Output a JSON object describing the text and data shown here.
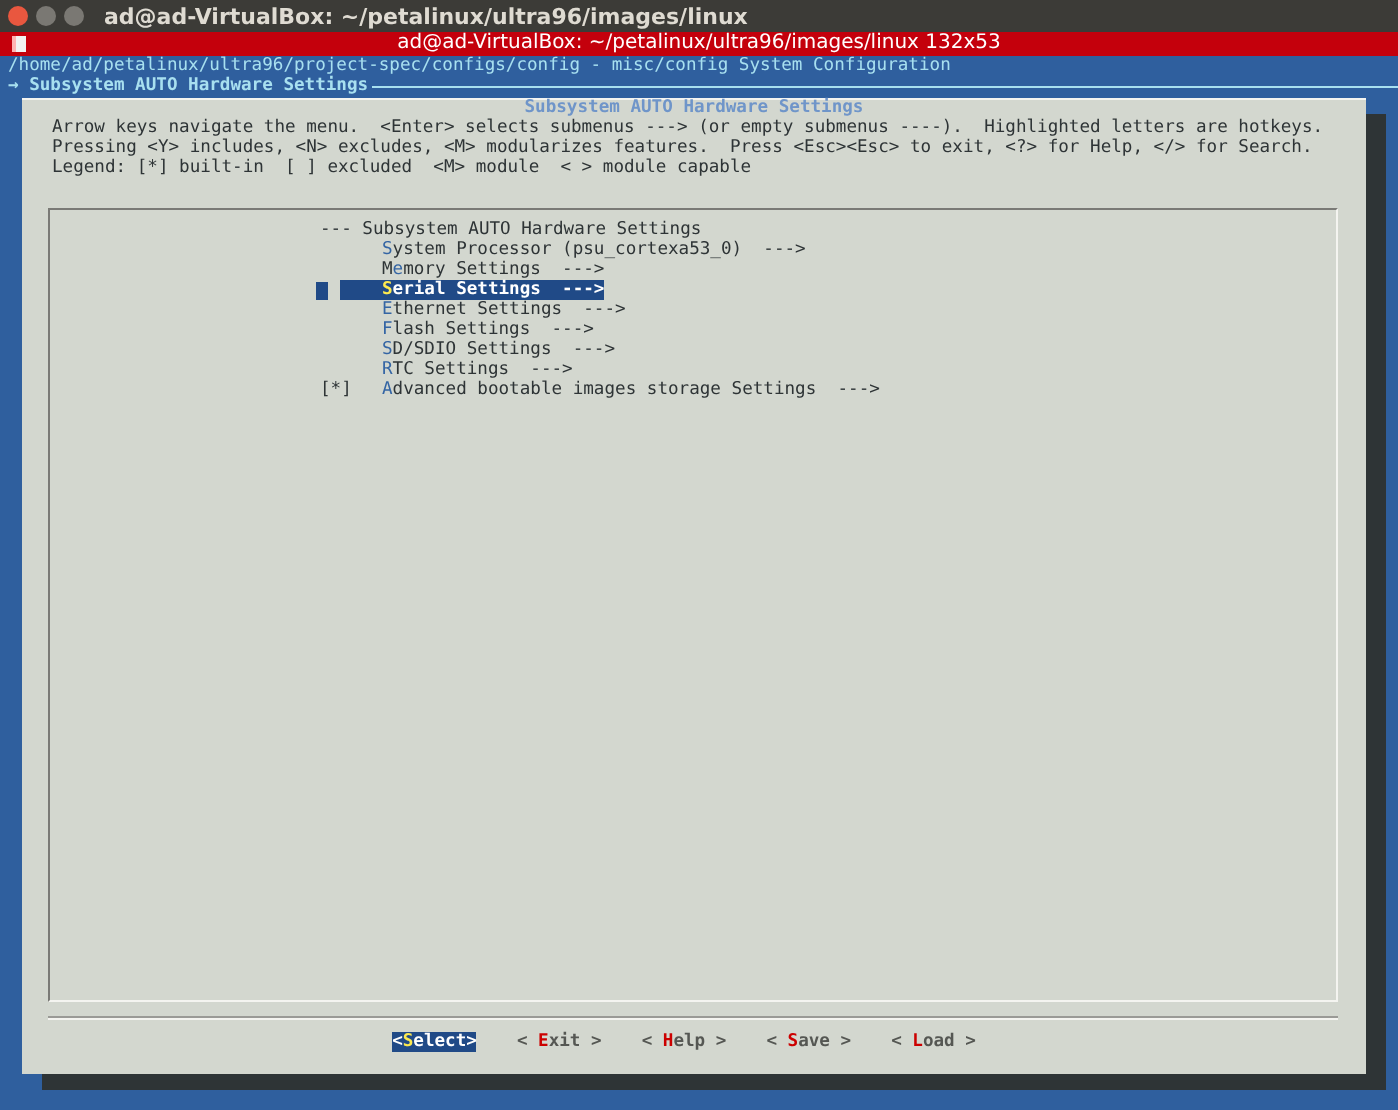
{
  "window": {
    "title": "ad@ad-VirtualBox: ~/petalinux/ultra96/images/linux"
  },
  "terminal": {
    "title": "ad@ad-VirtualBox: ~/petalinux/ultra96/images/linux 132x53",
    "path_line": "/home/ad/petalinux/ultra96/project-spec/configs/config - misc/config System Configuration",
    "breadcrumb": "→ Subsystem AUTO Hardware Settings"
  },
  "dialog": {
    "title": "Subsystem AUTO Hardware Settings",
    "help_lines": [
      "Arrow keys navigate the menu.  <Enter> selects submenus ---> (or empty submenus ----).  Highlighted letters are hotkeys.",
      "Pressing <Y> includes, <N> excludes, <M> modularizes features.  Press <Esc><Esc> to exit, <?> for Help, </> for Search.",
      "Legend: [*] built-in  [ ] excluded  <M> module  < > module capable"
    ],
    "menu_heading": "--- Subsystem AUTO Hardware Settings",
    "items": [
      {
        "hotkey": "S",
        "post": "ystem Processor (psu_cortexa53_0)  --->",
        "selected": false
      },
      {
        "pre": "M",
        "hotkey": "e",
        "post": "mory Settings  --->",
        "selected": false
      },
      {
        "hotkey": "S",
        "post": "erial Settings  --->",
        "selected": true
      },
      {
        "hotkey": "E",
        "post": "thernet Settings  --->",
        "selected": false
      },
      {
        "hotkey": "F",
        "post": "lash Settings  --->",
        "selected": false
      },
      {
        "hotkey": "S",
        "post": "D/SDIO Settings  --->",
        "selected": false
      },
      {
        "hotkey": "R",
        "post": "TC Settings  --->",
        "selected": false
      },
      {
        "marker": "[*]",
        "hotkey": "A",
        "post": "dvanced bootable images storage Settings  --->",
        "selected": false
      }
    ],
    "buttons": [
      {
        "pre": "<",
        "hotkey": "S",
        "post": "elect>",
        "selected": true
      },
      {
        "pre": "< ",
        "hotkey": "E",
        "post": "xit >",
        "selected": false
      },
      {
        "pre": "< ",
        "hotkey": "H",
        "post": "elp >",
        "selected": false
      },
      {
        "pre": "< ",
        "hotkey": "S",
        "post": "ave >",
        "selected": false
      },
      {
        "pre": "< ",
        "hotkey": "L",
        "post": "oad >",
        "selected": false
      }
    ]
  }
}
